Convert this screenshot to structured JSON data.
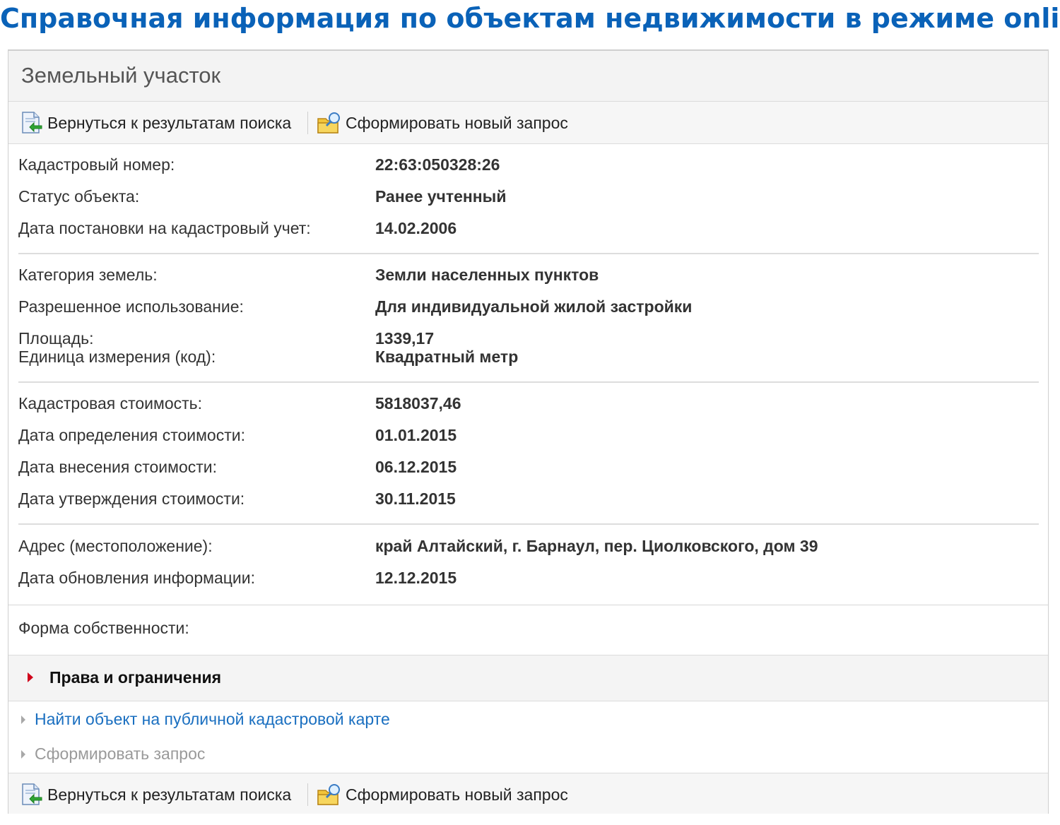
{
  "heading": "Справочная информация по объектам недвижимости в режиме online",
  "panel": {
    "title": "Земельный участок"
  },
  "toolbar": {
    "back_label": "Вернуться к результатам поиска",
    "new_request_label": "Сформировать новый запрос"
  },
  "details": {
    "cadastral_number": {
      "label": "Кадастровый номер:",
      "value": "22:63:050328:26"
    },
    "status": {
      "label": "Статус объекта:",
      "value": "Ранее учтенный"
    },
    "registration_date": {
      "label": "Дата постановки на кадастровый учет:",
      "value": "14.02.2006"
    },
    "land_category": {
      "label": "Категория земель:",
      "value": "Земли населенных пунктов"
    },
    "permitted_use": {
      "label": "Разрешенное использование:",
      "value": "Для индивидуальной жилой застройки"
    },
    "area": {
      "label": "Площадь:",
      "value": "1339,17"
    },
    "unit": {
      "label": "Единица измерения (код):",
      "value": "Квадратный метр"
    },
    "cadastral_value": {
      "label": "Кадастровая стоимость:",
      "value": "5818037,46"
    },
    "value_determination_date": {
      "label": "Дата определения стоимости:",
      "value": "01.01.2015"
    },
    "value_entry_date": {
      "label": "Дата внесения стоимости:",
      "value": "06.12.2015"
    },
    "value_approval_date": {
      "label": "Дата утверждения стоимости:",
      "value": "30.11.2015"
    },
    "address": {
      "label": "Адрес (местоположение):",
      "value": "край Алтайский, г. Барнаул, пер. Циолковского, дом 39"
    },
    "update_date": {
      "label": "Дата обновления информации:",
      "value": "12.12.2015"
    }
  },
  "ownership": {
    "label": "Форма собственности:"
  },
  "rights": {
    "label": "Права и ограничения"
  },
  "links": {
    "public_map": "Найти объект на публичной кадастровой карте",
    "make_request": "Сформировать запрос"
  },
  "colors": {
    "heading": "#0a62b8",
    "link": "#1a6fc0",
    "rights_arrow": "#d0021b",
    "disabled_link": "#9a9a9a"
  },
  "icons": {
    "back": "back-to-results-icon",
    "new_request": "new-request-icon"
  }
}
